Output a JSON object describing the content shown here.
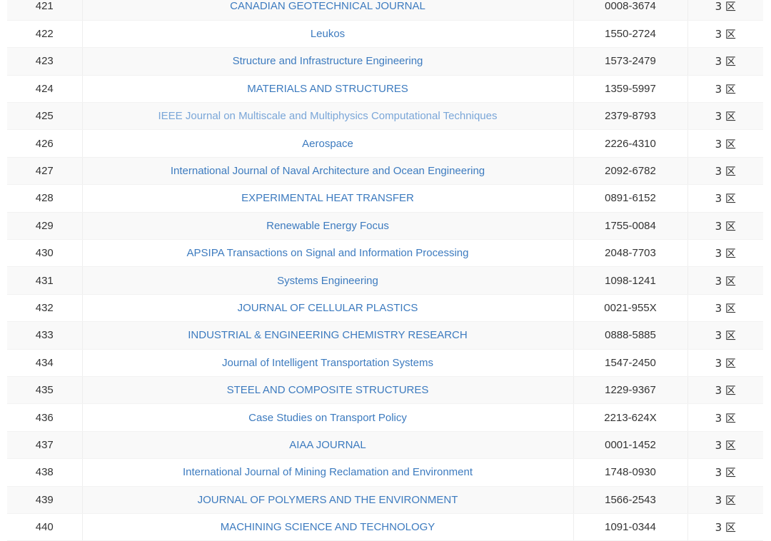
{
  "colors": {
    "link": "#3d7bbf",
    "link_visited": "#7aa6d8",
    "row_alt": "#f9f9f9",
    "text": "#333333"
  },
  "rows": [
    {
      "rank": "421",
      "name": "CANADIAN GEOTECHNICAL JOURNAL",
      "issn": "0008-3674",
      "zone": "3 区",
      "visited": false
    },
    {
      "rank": "422",
      "name": "Leukos",
      "issn": "1550-2724",
      "zone": "3 区",
      "visited": false
    },
    {
      "rank": "423",
      "name": "Structure and Infrastructure Engineering",
      "issn": "1573-2479",
      "zone": "3 区",
      "visited": false
    },
    {
      "rank": "424",
      "name": "MATERIALS AND STRUCTURES",
      "issn": "1359-5997",
      "zone": "3 区",
      "visited": false
    },
    {
      "rank": "425",
      "name": "IEEE Journal on Multiscale and Multiphysics Computational Techniques",
      "issn": "2379-8793",
      "zone": "3 区",
      "visited": true
    },
    {
      "rank": "426",
      "name": "Aerospace",
      "issn": "2226-4310",
      "zone": "3 区",
      "visited": false
    },
    {
      "rank": "427",
      "name": "International Journal of Naval Architecture and Ocean Engineering",
      "issn": "2092-6782",
      "zone": "3 区",
      "visited": false
    },
    {
      "rank": "428",
      "name": "EXPERIMENTAL HEAT TRANSFER",
      "issn": "0891-6152",
      "zone": "3 区",
      "visited": false
    },
    {
      "rank": "429",
      "name": "Renewable Energy Focus",
      "issn": "1755-0084",
      "zone": "3 区",
      "visited": false
    },
    {
      "rank": "430",
      "name": "APSIPA Transactions on Signal and Information Processing",
      "issn": "2048-7703",
      "zone": "3 区",
      "visited": false
    },
    {
      "rank": "431",
      "name": "Systems Engineering",
      "issn": "1098-1241",
      "zone": "3 区",
      "visited": false
    },
    {
      "rank": "432",
      "name": "JOURNAL OF CELLULAR PLASTICS",
      "issn": "0021-955X",
      "zone": "3 区",
      "visited": false
    },
    {
      "rank": "433",
      "name": "INDUSTRIAL & ENGINEERING CHEMISTRY RESEARCH",
      "issn": "0888-5885",
      "zone": "3 区",
      "visited": false
    },
    {
      "rank": "434",
      "name": "Journal of Intelligent Transportation Systems",
      "issn": "1547-2450",
      "zone": "3 区",
      "visited": false
    },
    {
      "rank": "435",
      "name": "STEEL AND COMPOSITE STRUCTURES",
      "issn": "1229-9367",
      "zone": "3 区",
      "visited": false
    },
    {
      "rank": "436",
      "name": "Case Studies on Transport Policy",
      "issn": "2213-624X",
      "zone": "3 区",
      "visited": false
    },
    {
      "rank": "437",
      "name": "AIAA JOURNAL",
      "issn": "0001-1452",
      "zone": "3 区",
      "visited": false
    },
    {
      "rank": "438",
      "name": "International Journal of Mining Reclamation and Environment",
      "issn": "1748-0930",
      "zone": "3 区",
      "visited": false
    },
    {
      "rank": "439",
      "name": "JOURNAL OF POLYMERS AND THE ENVIRONMENT",
      "issn": "1566-2543",
      "zone": "3 区",
      "visited": false
    },
    {
      "rank": "440",
      "name": "MACHINING SCIENCE AND TECHNOLOGY",
      "issn": "1091-0344",
      "zone": "3 区",
      "visited": false
    }
  ]
}
